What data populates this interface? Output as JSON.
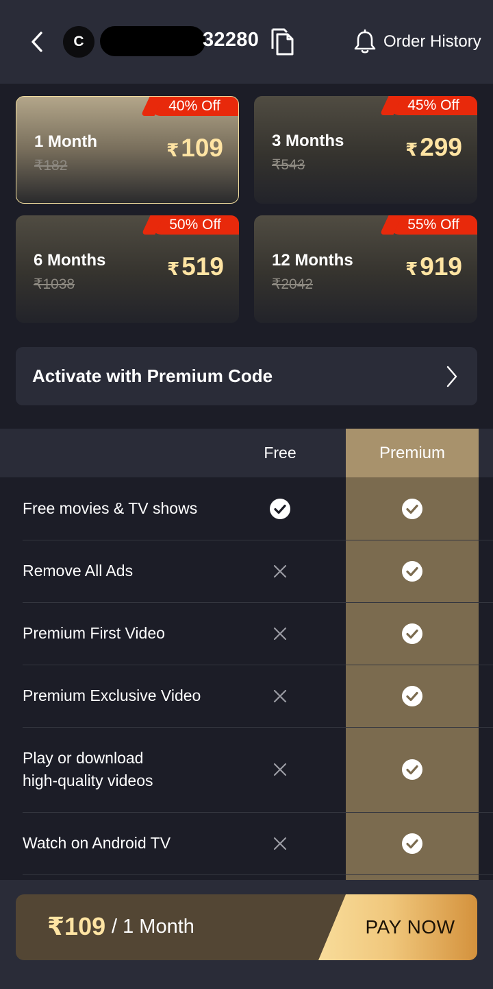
{
  "header": {
    "avatar_initial": "C",
    "user_id_visible": "32280",
    "order_history_label": "Order History"
  },
  "plans": [
    {
      "name": "1 Month",
      "old_price": "₹182",
      "currency": "₹",
      "price": "109",
      "discount": "40% Off",
      "selected": true
    },
    {
      "name": "3 Months",
      "old_price": "₹543",
      "currency": "₹",
      "price": "299",
      "discount": "45% Off",
      "selected": false
    },
    {
      "name": "6 Months",
      "old_price": "₹1038",
      "currency": "₹",
      "price": "519",
      "discount": "50% Off",
      "selected": false
    },
    {
      "name": "12 Months",
      "old_price": "₹2042",
      "currency": "₹",
      "price": "919",
      "discount": "55% Off",
      "selected": false
    }
  ],
  "premium_code": {
    "label": "Activate with Premium Code"
  },
  "comparison": {
    "free_header": "Free",
    "premium_header": "Premium",
    "rows": [
      {
        "feature": "Free movies & TV shows",
        "free": true,
        "premium": true
      },
      {
        "feature": "Remove All Ads",
        "free": false,
        "premium": true
      },
      {
        "feature": "Premium First Video",
        "free": false,
        "premium": true
      },
      {
        "feature": "Premium Exclusive Video",
        "free": false,
        "premium": true
      },
      {
        "feature": "Play or download high-quality videos",
        "free": false,
        "premium": true
      },
      {
        "feature": "Watch on Android TV",
        "free": false,
        "premium": true
      }
    ]
  },
  "footer": {
    "price": "₹109",
    "period": "/ 1 Month",
    "pay_label": "PAY NOW"
  },
  "colors": {
    "accent_gold": "#ffe4a3",
    "discount_red": "#e8290b",
    "premium_column": "#7b6b4f",
    "background": "#1c1d27"
  },
  "icons": [
    "back-chevron-icon",
    "copy-icon",
    "bell-icon",
    "chevron-right-icon",
    "check-circle-icon",
    "cross-icon"
  ]
}
